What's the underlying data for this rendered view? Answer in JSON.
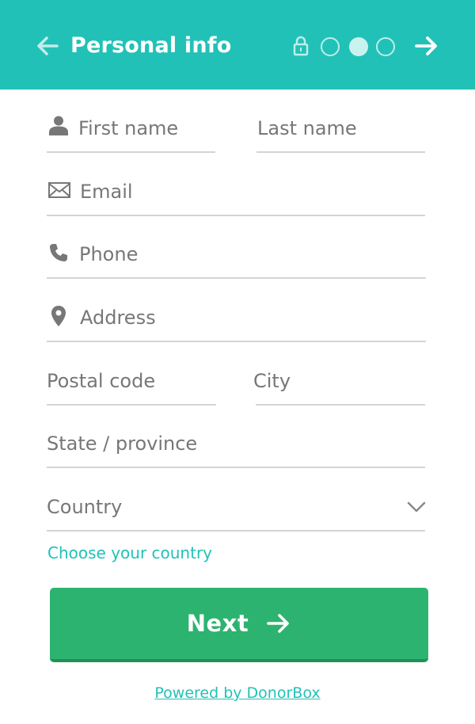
{
  "header": {
    "title": "Personal info",
    "back_icon": "arrow-left-icon",
    "forward_icon": "arrow-right-icon",
    "lock_icon": "lock-icon",
    "steps_total": 3,
    "active_step": 2
  },
  "form": {
    "first_name": {
      "placeholder": "First name",
      "icon": "person-icon"
    },
    "last_name": {
      "placeholder": "Last name"
    },
    "email": {
      "placeholder": "Email",
      "icon": "envelope-icon"
    },
    "phone": {
      "placeholder": "Phone",
      "icon": "phone-icon"
    },
    "address": {
      "placeholder": "Address",
      "icon": "map-pin-icon"
    },
    "postal_code": {
      "placeholder": "Postal code"
    },
    "city": {
      "placeholder": "City"
    },
    "state": {
      "placeholder": "State / province"
    },
    "country": {
      "placeholder": "Country",
      "icon": "chevron-down-icon"
    },
    "choose_country_link": "Choose your country"
  },
  "actions": {
    "next_label": "Next"
  },
  "footer": {
    "powered_by": "Powered by DonorBox"
  },
  "colors": {
    "header_bg": "#22c1b7",
    "accent": "#22c1b7",
    "button_bg": "#2db370",
    "divider": "#d4d4d4",
    "placeholder_text": "#777777"
  }
}
